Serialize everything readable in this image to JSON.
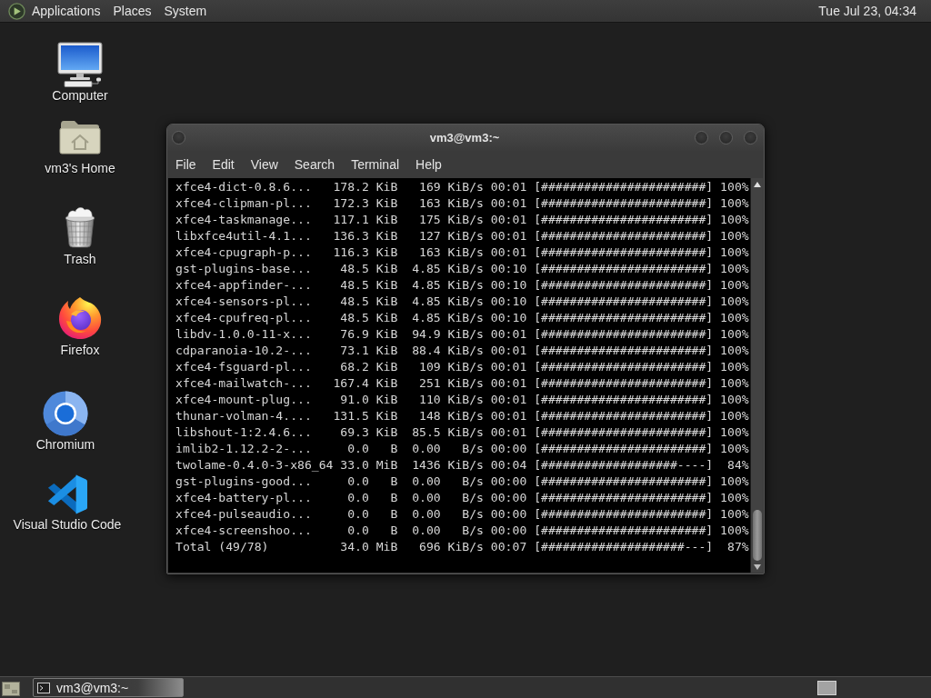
{
  "top_panel": {
    "menus": [
      "Applications",
      "Places",
      "System"
    ],
    "clock": "Tue Jul 23, 04:34"
  },
  "desktop_icons": [
    {
      "kind": "computer",
      "label": "Computer"
    },
    {
      "kind": "home",
      "label": "vm3's Home"
    },
    {
      "kind": "trash",
      "label": "Trash"
    },
    {
      "kind": "firefox",
      "label": "Firefox"
    },
    {
      "kind": "chromium",
      "label": "Chromium"
    },
    {
      "kind": "vscode",
      "label": "Visual Studio Code"
    }
  ],
  "terminal": {
    "title": "vm3@vm3:~",
    "menu": [
      "File",
      "Edit",
      "View",
      "Search",
      "Terminal",
      "Help"
    ],
    "lines": [
      "xfce4-dict-0.8.6...   178.2 KiB   169 KiB/s 00:01 [#######################] 100%",
      "xfce4-clipman-pl...   172.3 KiB   163 KiB/s 00:01 [#######################] 100%",
      "xfce4-taskmanage...   117.1 KiB   175 KiB/s 00:01 [#######################] 100%",
      "libxfce4util-4.1...   136.3 KiB   127 KiB/s 00:01 [#######################] 100%",
      "xfce4-cpugraph-p...   116.3 KiB   163 KiB/s 00:01 [#######################] 100%",
      "gst-plugins-base...    48.5 KiB  4.85 KiB/s 00:10 [#######################] 100%",
      "xfce4-appfinder-...    48.5 KiB  4.85 KiB/s 00:10 [#######################] 100%",
      "xfce4-sensors-pl...    48.5 KiB  4.85 KiB/s 00:10 [#######################] 100%",
      "xfce4-cpufreq-pl...    48.5 KiB  4.85 KiB/s 00:10 [#######################] 100%",
      "libdv-1.0.0-11-x...    76.9 KiB  94.9 KiB/s 00:01 [#######################] 100%",
      "cdparanoia-10.2-...    73.1 KiB  88.4 KiB/s 00:01 [#######################] 100%",
      "xfce4-fsguard-pl...    68.2 KiB   109 KiB/s 00:01 [#######################] 100%",
      "xfce4-mailwatch-...   167.4 KiB   251 KiB/s 00:01 [#######################] 100%",
      "xfce4-mount-plug...    91.0 KiB   110 KiB/s 00:01 [#######################] 100%",
      "thunar-volman-4....   131.5 KiB   148 KiB/s 00:01 [#######################] 100%",
      "libshout-1:2.4.6...    69.3 KiB  85.5 KiB/s 00:01 [#######################] 100%",
      "imlib2-1.12.2-2-...     0.0   B  0.00   B/s 00:00 [#######################] 100%",
      "twolame-0.4.0-3-x86_64 33.0 MiB  1436 KiB/s 00:04 [###################----]  84%",
      "gst-plugins-good...     0.0   B  0.00   B/s 00:00 [#######################] 100%",
      "xfce4-battery-pl...     0.0   B  0.00   B/s 00:00 [#######################] 100%",
      "xfce4-pulseaudio...     0.0   B  0.00   B/s 00:00 [#######################] 100%",
      "xfce4-screenshoo...     0.0   B  0.00   B/s 00:00 [#######################] 100%",
      "Total (49/78)          34.0 MiB   696 KiB/s 00:07 [####################---]  87%"
    ]
  },
  "taskbar": {
    "tasks": [
      {
        "label": "vm3@vm3:~",
        "selected": true
      }
    ]
  }
}
